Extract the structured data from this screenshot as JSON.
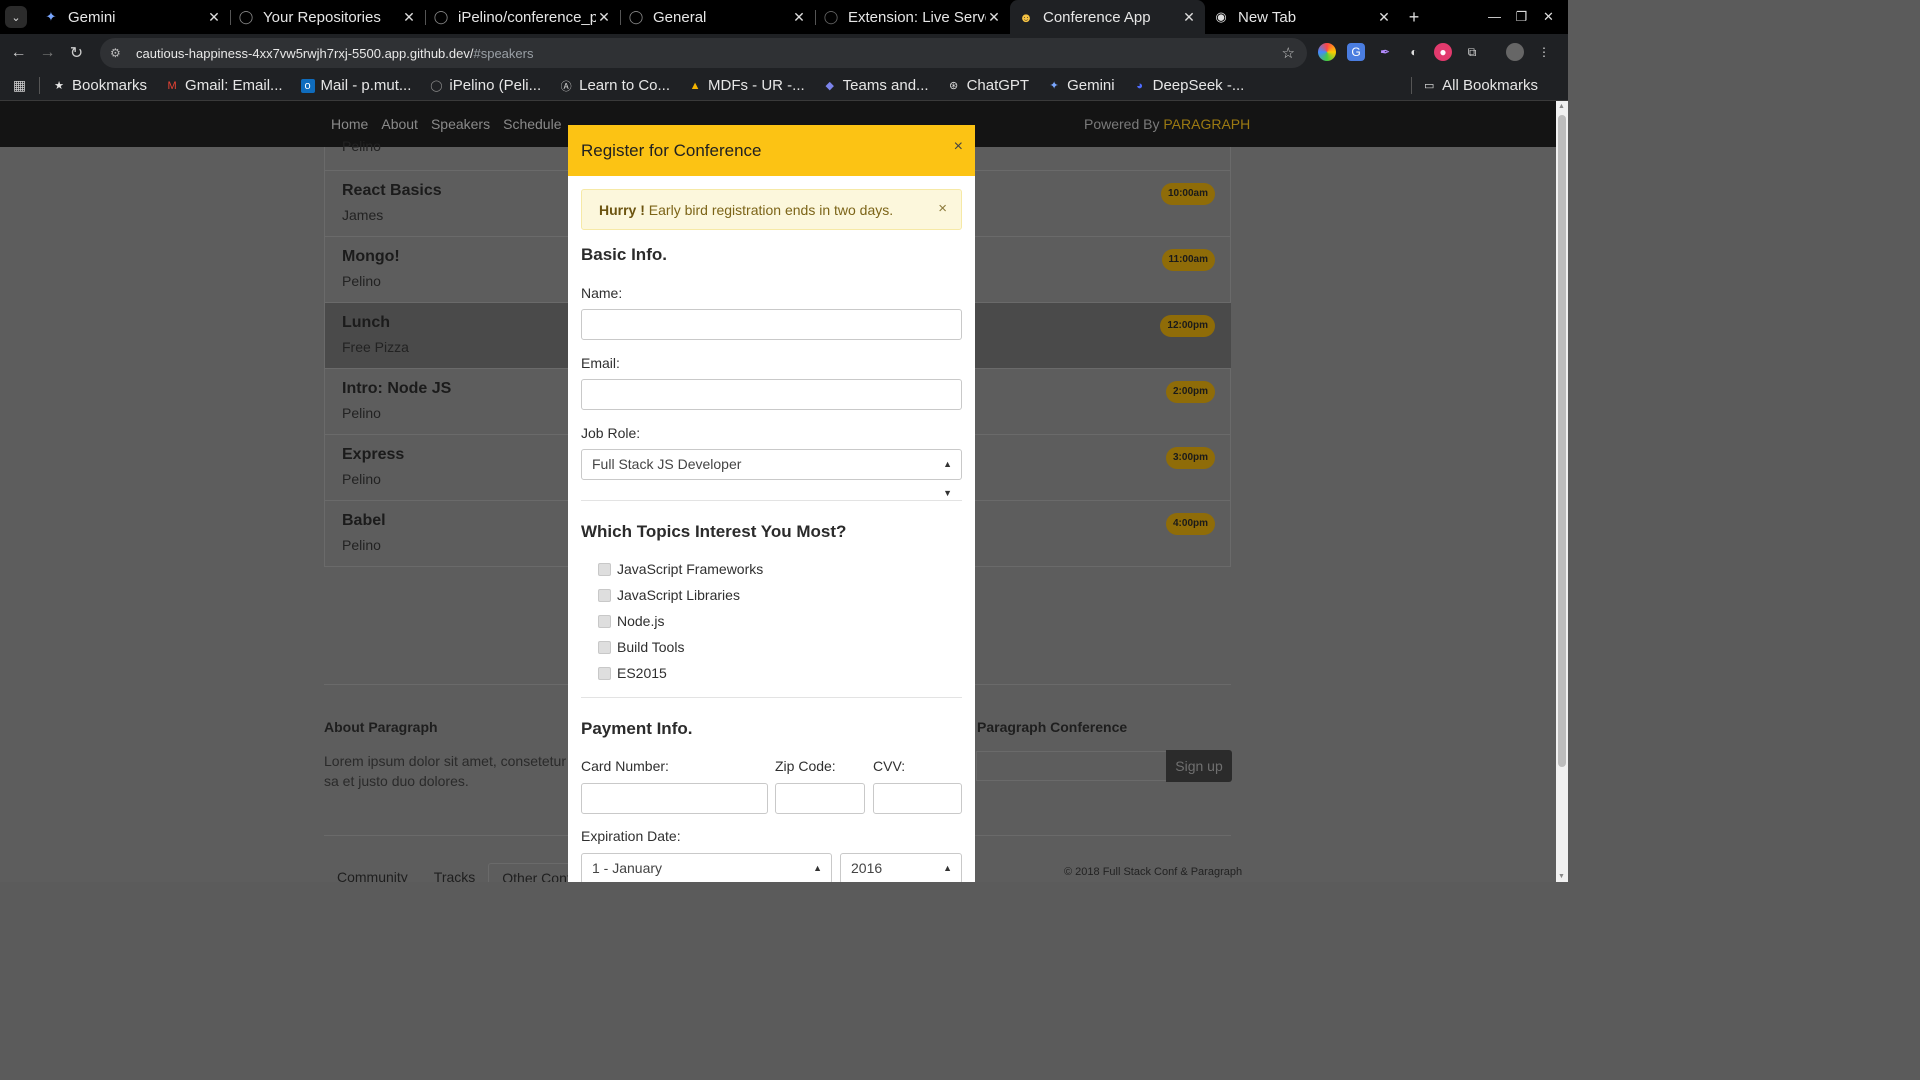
{
  "browser": {
    "tabs": [
      {
        "title": "Gemini",
        "icon": "gemini-icon",
        "active": false
      },
      {
        "title": "Your Repositories",
        "icon": "github-icon",
        "active": false
      },
      {
        "title": "iPelino/conference_p",
        "icon": "github-icon",
        "active": false
      },
      {
        "title": "General",
        "icon": "github-icon",
        "active": false
      },
      {
        "title": "Extension: Live Serve",
        "icon": "extension-icon",
        "active": false
      },
      {
        "title": "Conference App",
        "icon": "emoji-icon",
        "active": true
      },
      {
        "title": "New Tab",
        "icon": "chrome-icon",
        "active": false
      }
    ],
    "url_host": "cautious-happiness-4xx7vw5rwjh7rxj-5500.app.github.dev/",
    "url_path": "#speakers",
    "bookmarks": [
      {
        "label": "Bookmarks",
        "icon": "star-icon"
      },
      {
        "label": "Gmail: Email...",
        "icon": "gmail-icon"
      },
      {
        "label": "Mail - p.mut...",
        "icon": "outlook-icon"
      },
      {
        "label": "iPelino (Peli...",
        "icon": "github-icon"
      },
      {
        "label": "Learn to Co...",
        "icon": "code-icon"
      },
      {
        "label": "MDFs - UR -...",
        "icon": "drive-icon"
      },
      {
        "label": "Teams and...",
        "icon": "teams-icon"
      },
      {
        "label": "ChatGPT",
        "icon": "chatgpt-icon"
      },
      {
        "label": "Gemini",
        "icon": "gemini-icon"
      },
      {
        "label": "DeepSeek -...",
        "icon": "deepseek-icon"
      }
    ],
    "all_bookmarks": "All Bookmarks"
  },
  "site": {
    "nav": [
      "Home",
      "About",
      "Speakers",
      "Schedule"
    ],
    "powered_by": "Powered By",
    "brand": "PARAGRAPH",
    "cut_speaker": "Pelino",
    "sessions": [
      {
        "title": "React Basics",
        "speaker": "James",
        "time": "10:00am"
      },
      {
        "title": "Mongo!",
        "speaker": "Pelino",
        "time": "11:00am"
      },
      {
        "title": "Lunch",
        "speaker": "Free Pizza",
        "time": "12:00pm"
      },
      {
        "title": "Intro: Node JS",
        "speaker": "Pelino",
        "time": "2:00pm"
      },
      {
        "title": "Express",
        "speaker": "Pelino",
        "time": "3:00pm"
      },
      {
        "title": "Babel",
        "speaker": "Pelino",
        "time": "4:00pm"
      }
    ],
    "footer": {
      "about_heading": "About Paragraph",
      "about_text": "Lorem ipsum dolor sit amet, consetetur sa et justo duo dolores.",
      "conf_heading": "Paragraph Conference",
      "signup": "Sign up",
      "tabs": [
        "Community",
        "Tracks",
        "Other Confs"
      ],
      "copyright": "© 2018 Full Stack Conf & Paragraph"
    }
  },
  "modal": {
    "title": "Register for Conference",
    "close": "×",
    "alert_strong": "Hurry !",
    "alert_text": " Early bird registration ends in two days.",
    "alert_close": "×",
    "basic_heading": "Basic Info.",
    "name_label": "Name:",
    "email_label": "Email:",
    "job_label": "Job Role:",
    "job_value": "Full Stack JS Developer",
    "topics_heading": "Which Topics Interest You Most?",
    "topics": [
      "JavaScript Frameworks",
      "JavaScript Libraries",
      "Node.js",
      "Build Tools",
      "ES2015"
    ],
    "payment_heading": "Payment Info.",
    "card_label": "Card Number:",
    "zip_label": "Zip Code:",
    "cvv_label": "CVV:",
    "exp_label": "Expiration Date:",
    "exp_month": "1 - January",
    "exp_year": "2016"
  },
  "colors": {
    "modal_header": "#fcc314",
    "brand": "#9c7a12",
    "time_badge": "#8f6c08"
  }
}
